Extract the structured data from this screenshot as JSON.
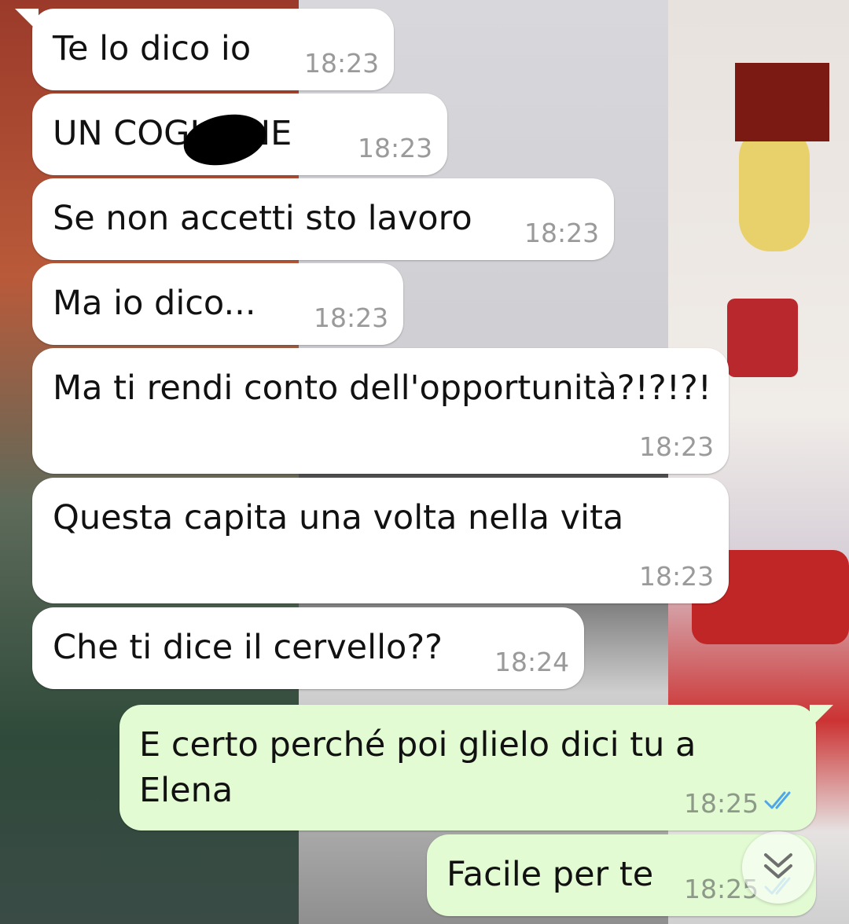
{
  "messages": [
    {
      "text": "Te lo dico io",
      "time": "18:23"
    },
    {
      "text": "UN COGLIONE",
      "time": "18:23"
    },
    {
      "text": "Se non accetti sto lavoro",
      "time": "18:23"
    },
    {
      "text": "Ma io dico...",
      "time": "18:23"
    },
    {
      "text": "Ma ti rendi conto dell'opportunità?!?!?!",
      "time": "18:23"
    },
    {
      "text": "Questa capita una volta nella vita",
      "time": "18:23"
    },
    {
      "text": "Che ti dice il cervello??",
      "time": "18:24"
    },
    {
      "text": "E certo perché poi glielo dici tu a\nElena",
      "time": "18:25",
      "status": "read"
    },
    {
      "text": "Facile per te",
      "time": "18:25",
      "status": "read"
    }
  ],
  "colors": {
    "incoming_bubble": "#ffffff",
    "outgoing_bubble": "#e2fbd3",
    "read_ticks": "#4fa6e8"
  },
  "icons": {
    "read_receipt": "double-check-icon",
    "scroll_down": "double-chevron-down-icon"
  }
}
